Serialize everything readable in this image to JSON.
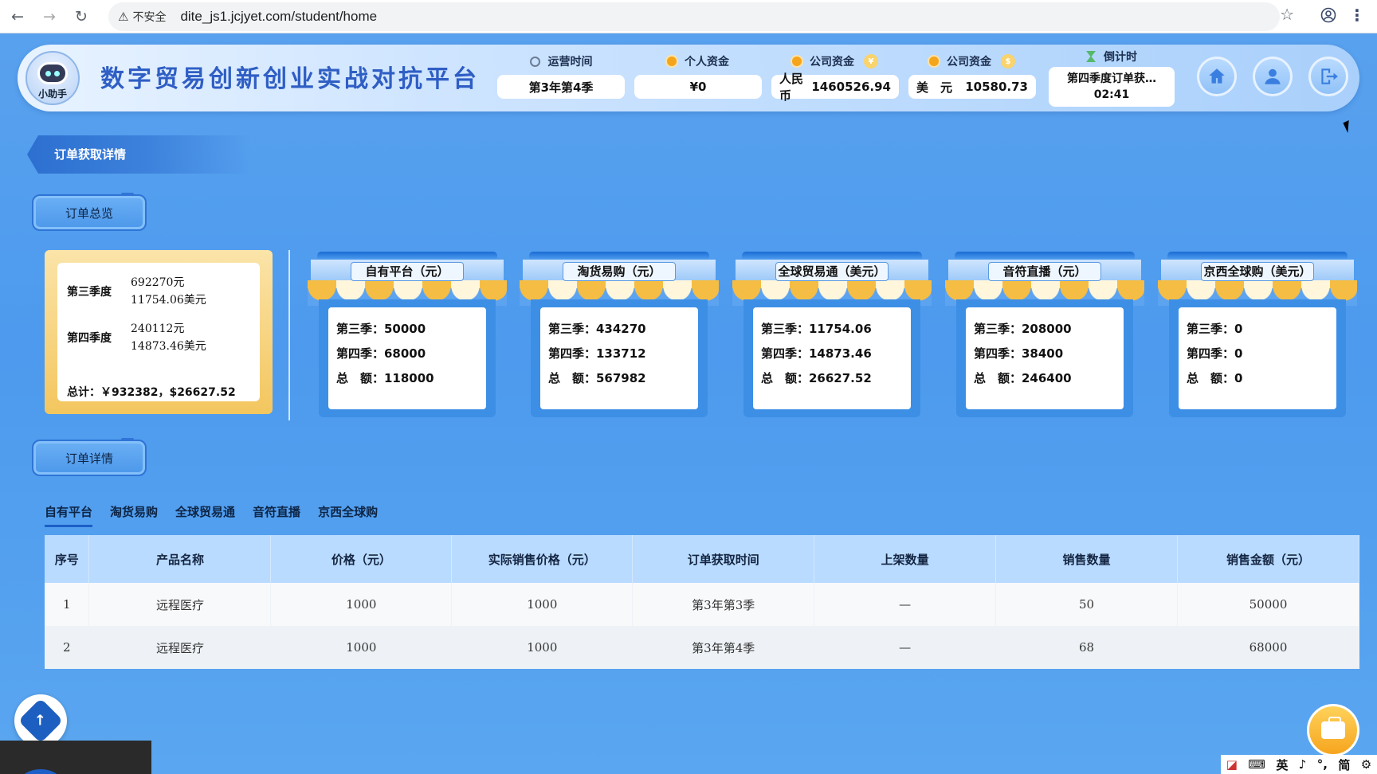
{
  "browser": {
    "security_label": "不安全",
    "url": "dite_js1.jcjyet.com/student/home"
  },
  "header": {
    "logo_label": "小助手",
    "title": "数字贸易创新创业实战对抗平台",
    "run_time": {
      "label": "运营时间",
      "value": "第3年第4季"
    },
    "personal_funds": {
      "label": "个人资金",
      "value": "¥0"
    },
    "company_funds_cny": {
      "label": "公司资金",
      "currency": "人民币",
      "value": "1460526.94"
    },
    "company_funds_usd": {
      "label": "公司资金",
      "currency": "美　元",
      "value": "10580.73"
    },
    "countdown": {
      "label": "倒计时",
      "text": "第四季度订单获…",
      "time": "02:41"
    }
  },
  "section_title": "订单获取详情",
  "overview_button": "订单总览",
  "details_button": "订单详情",
  "summary": {
    "q3_label": "第三季度",
    "q3_cny": "692270元",
    "q3_usd": "11754.06美元",
    "q4_label": "第四季度",
    "q4_cny": "240112元",
    "q4_usd": "14873.46美元",
    "total": "总计：￥932382，$26627.52"
  },
  "platforms": [
    {
      "name": "自有平台（元）",
      "q3": "第三季：50000",
      "q4": "第四季：68000",
      "total": "总　额：118000"
    },
    {
      "name": "淘货易购（元）",
      "q3": "第三季：434270",
      "q4": "第四季：133712",
      "total": "总　额：567982"
    },
    {
      "name": "全球贸易通（美元）",
      "q3": "第三季：11754.06",
      "q4": "第四季：14873.46",
      "total": "总　额：26627.52"
    },
    {
      "name": "音符直播（元）",
      "q3": "第三季：208000",
      "q4": "第四季：38400",
      "total": "总　额：246400"
    },
    {
      "name": "京西全球购（美元）",
      "q3": "第三季：0",
      "q4": "第四季：0",
      "total": "总　额：0"
    }
  ],
  "tabs": [
    "自有平台",
    "淘货易购",
    "全球贸易通",
    "音符直播",
    "京西全球购"
  ],
  "active_tab": "自有平台",
  "table": {
    "headers": [
      "序号",
      "产品名称",
      "价格（元）",
      "实际销售价格（元）",
      "订单获取时间",
      "上架数量",
      "销售数量",
      "销售金额（元）"
    ],
    "rows": [
      [
        "1",
        "远程医疗",
        "1000",
        "1000",
        "第3年第3季",
        "—",
        "50",
        "50000"
      ],
      [
        "2",
        "远程医疗",
        "1000",
        "1000",
        "第3年第4季",
        "—",
        "68",
        "68000"
      ]
    ]
  },
  "ime": [
    "英",
    "简"
  ]
}
